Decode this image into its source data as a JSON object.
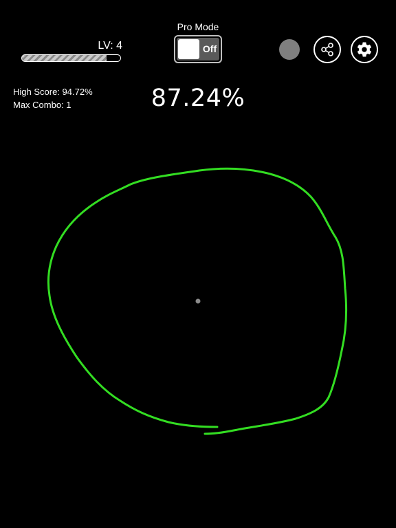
{
  "header": {
    "level_label": "LV: 4",
    "level_progress": 0.86,
    "pro_mode_label": "Pro Mode",
    "pro_mode_state": "Off"
  },
  "icons": {
    "status": "status-dot",
    "share": "share-icon",
    "settings": "gear-icon"
  },
  "stats": {
    "high_score": "High Score: 94.72%",
    "max_combo": "Max Combo: 1"
  },
  "score": {
    "current": "87.24%"
  },
  "colors": {
    "stroke": "#33dd22",
    "center_dot": "#8a8a8a",
    "status_dot": "#7f7f7f",
    "background": "#000000"
  }
}
